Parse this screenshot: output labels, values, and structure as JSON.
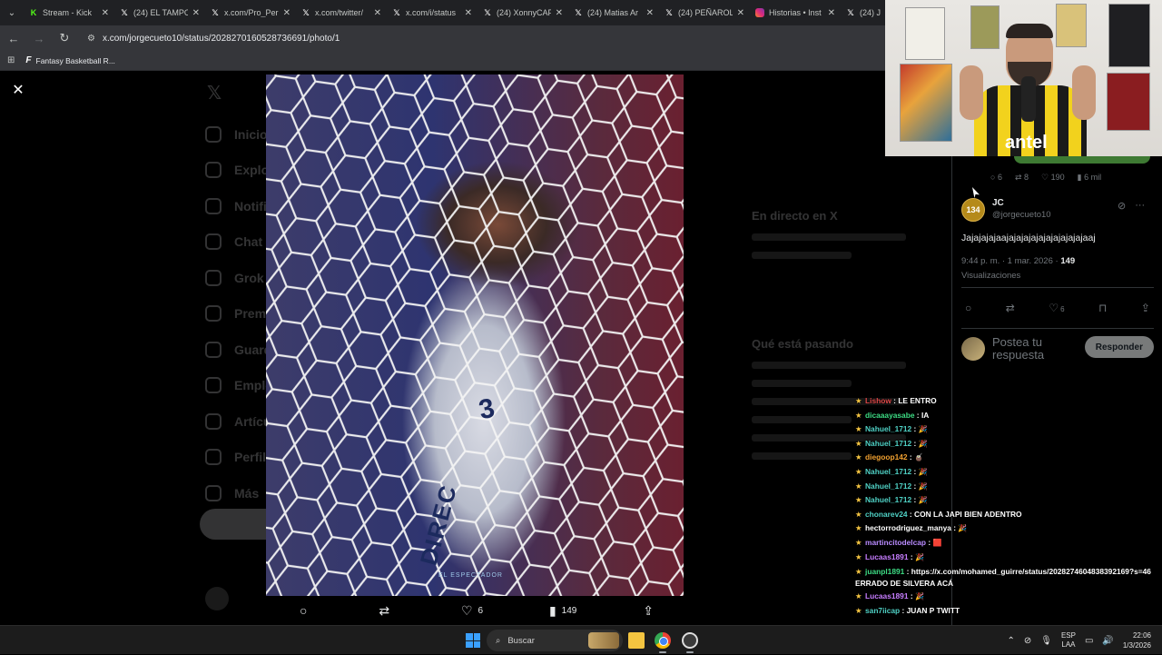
{
  "browser": {
    "tabs": [
      {
        "icon": "kick-icon",
        "label": "Stream - Kick"
      },
      {
        "icon": "x-logo-icon",
        "label": "(24) EL TAMPO"
      },
      {
        "icon": "x-logo-icon",
        "label": "x.com/Pro_Per"
      },
      {
        "icon": "x-logo-icon",
        "label": "x.com/twitter/"
      },
      {
        "icon": "x-logo-icon",
        "label": "x.com/i/status"
      },
      {
        "icon": "x-logo-icon",
        "label": "(24) XonnyCAP"
      },
      {
        "icon": "x-logo-icon",
        "label": "(24) Matias Ar"
      },
      {
        "icon": "x-logo-icon",
        "label": "(24) PEÑAROL"
      },
      {
        "icon": "instagram-icon",
        "label": "Historias • Inst"
      },
      {
        "icon": "x-logo-icon",
        "label": "(24) J"
      }
    ],
    "url": "x.com/jorgecueto10/status/2028270160528736691/photo/1",
    "bookmark": "Fantasy Basketball R..."
  },
  "photo_view": {
    "close_glyph": "✕",
    "jersey_number": "3",
    "jersey_brand": "DIREC",
    "watermark": "EL ESPECTADOR",
    "actions": {
      "comments": "",
      "reposts": "",
      "likes": "6",
      "views": "149"
    }
  },
  "background_page": {
    "nav": [
      "Inicio",
      "Explorar",
      "Notificaciones",
      "Chat",
      "Grok",
      "Premium",
      "Guardados",
      "Empleos",
      "Artículos",
      "Perfil",
      "Más"
    ],
    "right_heading_1": "En directo en X",
    "right_heading_2": "Qué está pasando"
  },
  "side_panel": {
    "prev_stats": {
      "replies": "6",
      "reposts": "8",
      "likes": "190",
      "views": "6 mil"
    },
    "reply": {
      "avatar_text": "134",
      "name": "JC",
      "handle": "@jorgecueto10",
      "text": "Jajajajajaajajajajajajajajajajajaaj",
      "time": "9:44 p. m. · 1 mar. 2026 ·",
      "views_count": "149",
      "views_label": "Visualizaciones",
      "likes": "6"
    },
    "compose_placeholder": "Postea tu respuesta",
    "reply_button": "Responder"
  },
  "webcam": {
    "sponsor_text": "antel"
  },
  "chat": [
    {
      "user": "Lishow",
      "color": "#e04a4a",
      "text": "LE ENTRO",
      "emo": ""
    },
    {
      "user": "dicaaayasabe",
      "color": "#3ddc84",
      "text": "IA",
      "emo": ""
    },
    {
      "user": "Nahuel_1712",
      "color": "#4fd1c5",
      "text": "",
      "emo": "🎉"
    },
    {
      "user": "Nahuel_1712",
      "color": "#4fd1c5",
      "text": "",
      "emo": "🎉"
    },
    {
      "user": "diegoop142",
      "color": "#f0a030",
      "text": "",
      "emo": "🧉"
    },
    {
      "user": "Nahuel_1712",
      "color": "#4fd1c5",
      "text": "",
      "emo": "🎉"
    },
    {
      "user": "Nahuel_1712",
      "color": "#4fd1c5",
      "text": "",
      "emo": "🎉"
    },
    {
      "user": "Nahuel_1712",
      "color": "#4fd1c5",
      "text": "",
      "emo": "🎉"
    },
    {
      "user": "chonarev24",
      "color": "#4fd1c5",
      "text": "CON LA JAPI BIEN ADENTRO",
      "emo": ""
    },
    {
      "user": "hectorrodriguez_manya",
      "color": "#ffffff",
      "text": "",
      "emo": "🎉"
    },
    {
      "user": "martincitodelcap",
      "color": "#b98bff",
      "text": "",
      "emo": "🟥"
    },
    {
      "user": "Lucaas1891",
      "color": "#c77dff",
      "text": "",
      "emo": "🎉"
    },
    {
      "user": "juanpl1891",
      "color": "#3ddc84",
      "text": "https://x.com/mohamed_guirre/status/2028274604838392169?s=46 ERRADO DE SILVERA ACÁ",
      "emo": ""
    },
    {
      "user": "Lucaas1891",
      "color": "#c77dff",
      "text": "",
      "emo": "🎉"
    },
    {
      "user": "san7iicap",
      "color": "#4fd1c5",
      "text": "JUAN P TWITT",
      "emo": ""
    }
  ],
  "taskbar": {
    "search_label": "Buscar",
    "lang_1": "ESP",
    "lang_2": "LAA",
    "time": "22:06",
    "date": "1/3/2026"
  }
}
